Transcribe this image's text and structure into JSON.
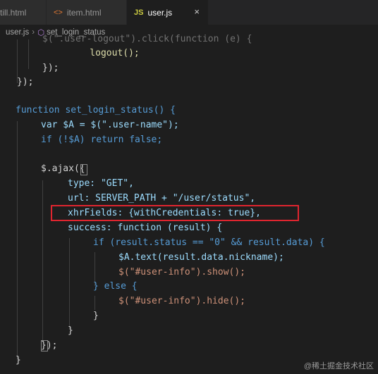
{
  "tabs": [
    {
      "label": "till.html",
      "icon": "html-icon",
      "active": false
    },
    {
      "label": "item.html",
      "icon": "html-icon",
      "active": false
    },
    {
      "label": "user.js",
      "icon": "js-icon",
      "active": true
    }
  ],
  "tab_icons": {
    "html": "<>",
    "js": "JS",
    "close": "×"
  },
  "breadcrumb": {
    "file": "user.js",
    "symbol": "set_login_status"
  },
  "code_lines": [
    "$(\".user-logout\").click(function (e) {",
    "    logout();",
    "});",
    "});",
    "",
    "function set_login_status() {",
    "var $A = $(\".user-name\");",
    "if (!$A) return false;",
    "",
    "$.ajax({",
    "type: \"GET\",",
    "url: SERVER_PATH + \"/user/status\",",
    "xhrFields: {withCredentials: true},",
    "success: function (result) {",
    "if (result.status == \"0\" && result.data) {",
    "$A.text(result.data.nickname);",
    "$(\"#user-info\").show();",
    "} else {",
    "$(\"#user-info\").hide();",
    "}",
    "}",
    "});",
    "}"
  ],
  "highlight_color": "#e0252f",
  "watermark": "@稀土掘金技术社区"
}
